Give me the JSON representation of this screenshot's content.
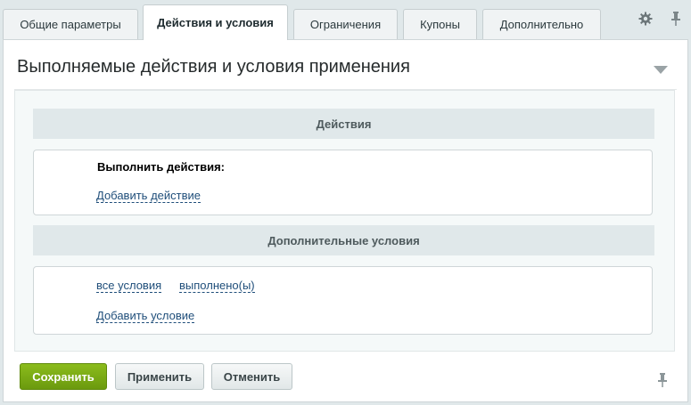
{
  "tabs": [
    {
      "label": "Общие параметры",
      "active": false
    },
    {
      "label": "Действия и условия",
      "active": true
    },
    {
      "label": "Ограничения",
      "active": false
    },
    {
      "label": "Купоны",
      "active": false
    },
    {
      "label": "Дополнительно",
      "active": false
    }
  ],
  "tab_tools": {
    "settings_icon": "gear-icon",
    "pin_icon": "pin-icon"
  },
  "panel": {
    "title": "Выполняемые действия и условия применения",
    "collapse_icon": "triangle-down-icon"
  },
  "actions_section": {
    "header": "Действия",
    "label": "Выполнить действия:",
    "add_link": "Добавить действие"
  },
  "conditions_section": {
    "header": "Дополнительные условия",
    "selector_all": "все условия",
    "selector_done": "выполнено(ы)",
    "add_link": "Добавить условие"
  },
  "footer": {
    "save_label": "Сохранить",
    "apply_label": "Применить",
    "cancel_label": "Отменить",
    "pin_icon": "pin-icon"
  },
  "colors": {
    "accent_green": "#7aab15",
    "link_blue": "#1f4e7a",
    "background": "#e0e8ea"
  }
}
